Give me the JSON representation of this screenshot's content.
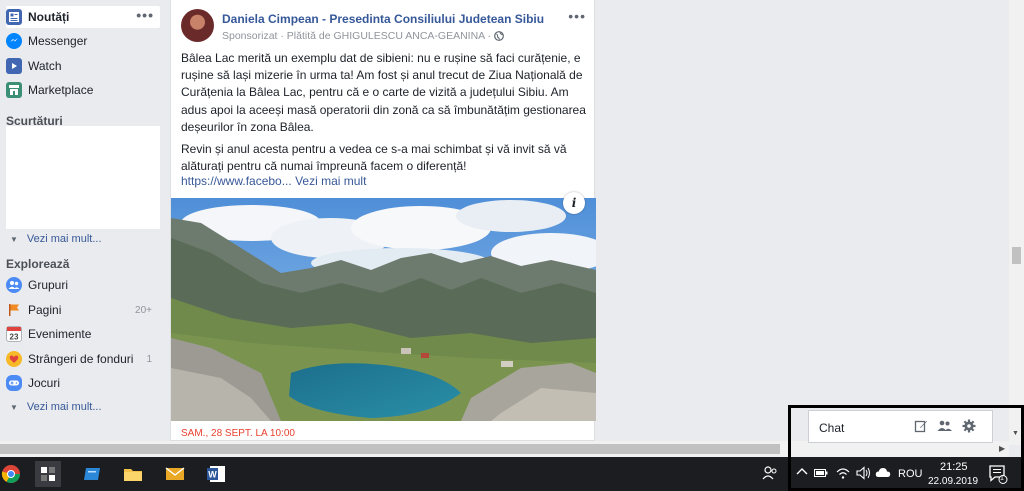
{
  "sidebar": {
    "items": [
      {
        "label": "Noutăți",
        "icon": "news-feed-icon"
      },
      {
        "label": "Messenger",
        "icon": "messenger-icon"
      },
      {
        "label": "Watch",
        "icon": "watch-icon"
      },
      {
        "label": "Marketplace",
        "icon": "marketplace-icon"
      }
    ],
    "shortcuts_title": "Scurtături",
    "see_more_1": "Vezi mai mult...",
    "explore_title": "Explorează",
    "explore_items": [
      {
        "label": "Grupuri",
        "count": "",
        "icon": "groups-icon"
      },
      {
        "label": "Pagini",
        "count": "20+",
        "icon": "pages-flag-icon"
      },
      {
        "label": "Evenimente",
        "count": "",
        "icon": "calendar-icon"
      },
      {
        "label": "Strângeri de fonduri",
        "count": "1",
        "icon": "fundraiser-icon"
      },
      {
        "label": "Jocuri",
        "count": "",
        "icon": "games-controller-icon"
      }
    ],
    "see_more_2": "Vezi mai mult..."
  },
  "post": {
    "author": "Daniela Cimpean - Presedinta Consiliului Judetean Sibiu",
    "meta_sponsored": "Sponsorizat",
    "meta_paid": "Plătită de GHIGULESCU ANCA-GEANINA",
    "paragraph_1": "Bâlea Lac merită un exemplu dat de sibieni: nu e rușine să faci curățenie, e rușine să lași mizerie în urma ta! Am fost și anul trecut de Ziua Națională de Curățenia la Bâlea Lac, pentru că e o carte de vizită a județului Sibiu. Am adus apoi la aceeși masă operatorii din zonă ca să îmbunătățim gestionarea deșeurilor în zona Bâlea.",
    "paragraph_2": "Revin și anul acesta pentru a vedea ce s-a mai schimbat și vă invit să vă alăturați pentru că numai împreună facem o diferență!",
    "link_url": "https://www.facebo...",
    "link_see_more": "Vezi mai mult",
    "info_label": "i",
    "event_date": "SAM., 28 SEPT. LA 10:00"
  },
  "chat": {
    "label": "Chat"
  },
  "taskbar": {
    "language": "ROU",
    "time": "21:25",
    "date": "22.09.2019",
    "notification_count": "1"
  },
  "colors": {
    "background": "#e9ebee",
    "link": "#385898",
    "author": "#365899",
    "event_red": "#e8412f",
    "taskbar": "#1c1d21"
  }
}
